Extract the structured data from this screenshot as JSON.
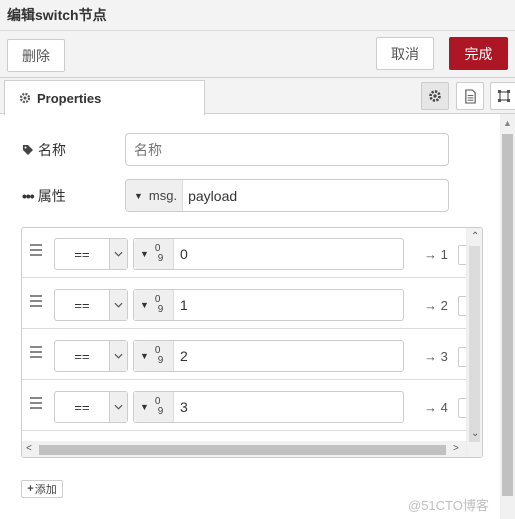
{
  "window": {
    "title": "编辑switch节点"
  },
  "actions": {
    "delete_label": "删除",
    "cancel_label": "取消",
    "done_label": "完成"
  },
  "tabs": {
    "properties_label": "Properties"
  },
  "form": {
    "name_label": "名称",
    "name_placeholder": "名称",
    "property_label": "属性",
    "property_type": "msg.",
    "property_value": "payload"
  },
  "rules": [
    {
      "operator": "==",
      "value": "0",
      "output": "→ 1"
    },
    {
      "operator": "==",
      "value": "1",
      "output": "→ 2"
    },
    {
      "operator": "==",
      "value": "2",
      "output": "→ 3"
    },
    {
      "operator": "==",
      "value": "3",
      "output": "→ 4"
    }
  ],
  "add_label": "添加",
  "watermark": "@51CTO博客",
  "colors": {
    "accent": "#ad1625",
    "border": "#cccccc",
    "toolbar_bg": "#f3f3f3"
  }
}
